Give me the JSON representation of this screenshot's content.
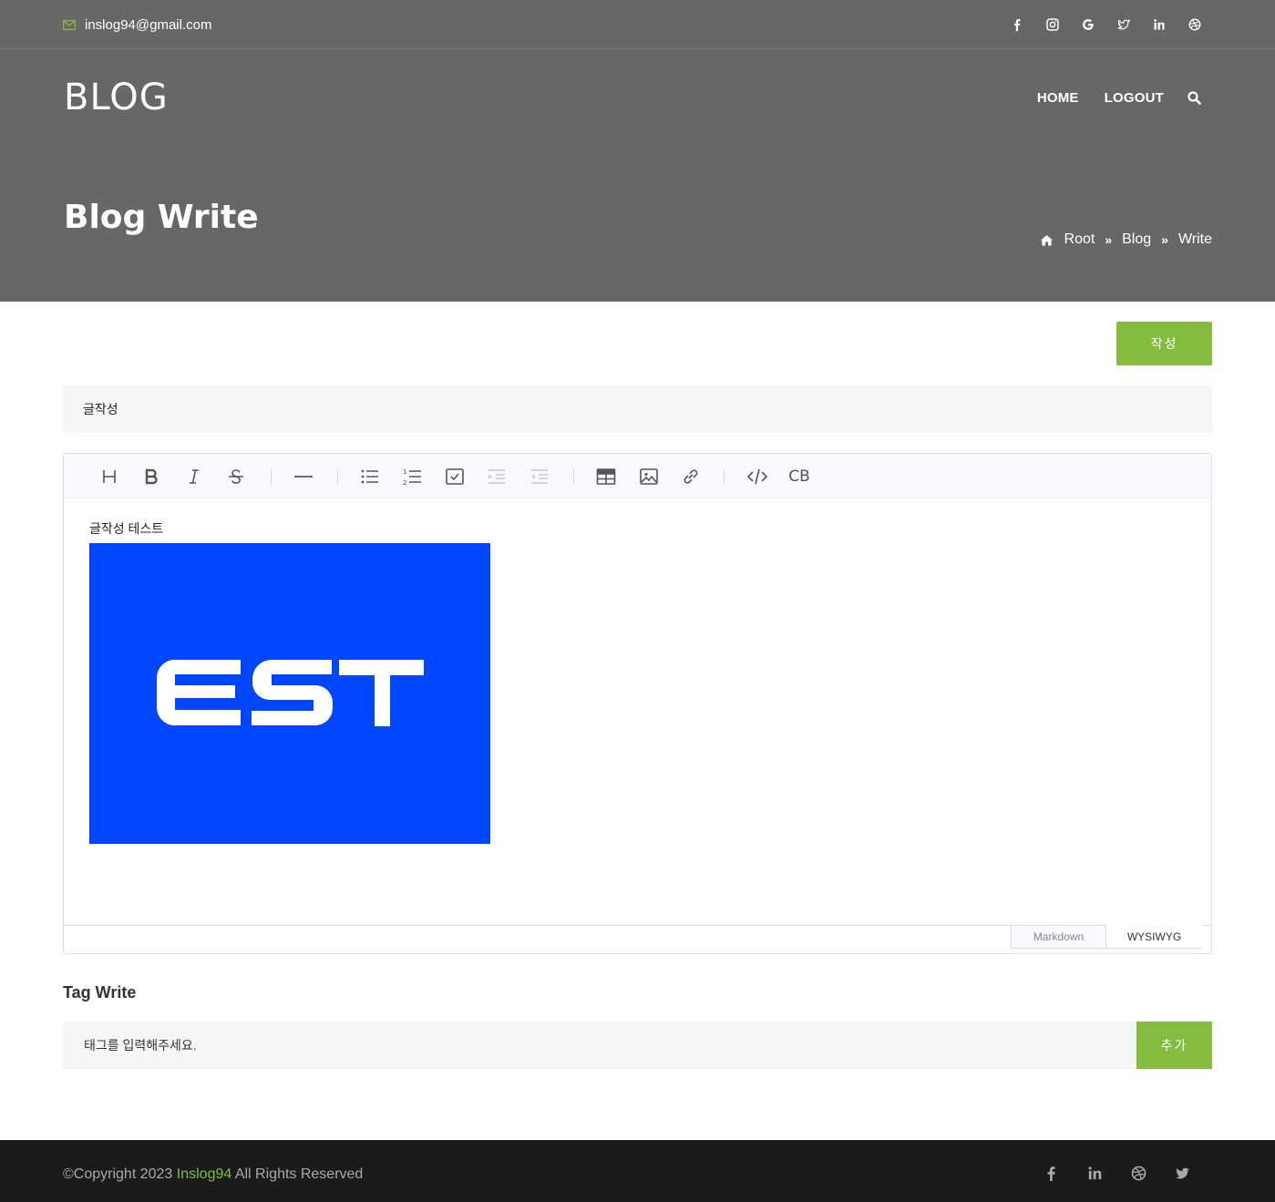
{
  "topbar": {
    "email": "inslog94@gmail.com",
    "social_icons": [
      "facebook-icon",
      "instagram-icon",
      "google-icon",
      "twitter-icon",
      "linkedin-icon",
      "dribbble-icon"
    ]
  },
  "header": {
    "brand": "BLOG",
    "nav": {
      "home": "HOME",
      "logout": "LOGOUT"
    }
  },
  "hero": {
    "title": "Blog Write",
    "breadcrumb": [
      "Root",
      "Blog",
      "Write"
    ]
  },
  "form": {
    "submit_label": "작성",
    "title_value": "글작성",
    "editor": {
      "content_text": "글작성 테스트",
      "image_text": "EST",
      "image_bg": "#0047ff",
      "toolbar": [
        "heading",
        "bold",
        "italic",
        "strike",
        "hr",
        "bullet-list",
        "ordered-list",
        "task-list",
        "indent",
        "outdent",
        "table",
        "image",
        "link",
        "code",
        "codeblock"
      ],
      "codeblock_label": "CB",
      "modes": {
        "markdown": "Markdown",
        "wysiwyg": "WYSIWYG"
      }
    },
    "tag_heading": "Tag Write",
    "tag_placeholder": "태그를 입력해주세요.",
    "tag_add_label": "추가"
  },
  "footer": {
    "copyright_prefix": "©Copyright 2023",
    "copyright_brand": "Inslog94",
    "copyright_suffix": "All Rights Reserved",
    "social_icons": [
      "facebook-icon",
      "linkedin-icon",
      "dribbble-icon",
      "twitter-icon"
    ]
  },
  "colors": {
    "accent": "#85bb3f",
    "hero_bg": "#676767",
    "footer_bg": "#1b1b1b"
  }
}
